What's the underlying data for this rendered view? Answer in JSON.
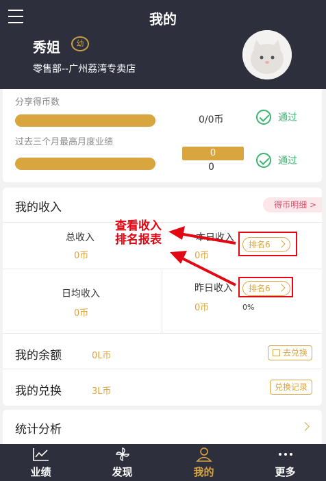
{
  "header": {
    "title": "我的",
    "user_name": "秀姐",
    "badge": "幼",
    "department": "零售部--广州荔湾专卖店"
  },
  "requirements": [
    {
      "label": "分享得币数",
      "value": "0/0币",
      "status": "通过"
    },
    {
      "label": "过去三个月最高月度业绩",
      "box_value": "0",
      "value": "0",
      "status": "通过"
    }
  ],
  "income": {
    "title": "我的收入",
    "detail_link": "得币明细 >",
    "total": {
      "label": "总收入",
      "value": "0币"
    },
    "today": {
      "label": "本日收入",
      "value": "0币",
      "rank": "排名6"
    },
    "daily_avg": {
      "label": "日均收入",
      "value": "0币"
    },
    "yesterday": {
      "label": "昨日收入",
      "value": "0币",
      "rank": "排名6",
      "percent": "0%"
    },
    "annotation": [
      "查看收入",
      "排名报表"
    ]
  },
  "balance": {
    "label": "我的余额",
    "value": "0L币",
    "action": "去兑换"
  },
  "exchange": {
    "label": "我的兑换",
    "value": "3L币",
    "action": "兑换记录"
  },
  "stats": {
    "label": "统计分析"
  },
  "nav": [
    {
      "label": "业绩",
      "icon": "chart-icon"
    },
    {
      "label": "发现",
      "icon": "pinwheel-icon"
    },
    {
      "label": "我的",
      "icon": "person-icon",
      "active": true
    },
    {
      "label": "更多",
      "icon": "more-icon"
    }
  ],
  "colors": {
    "header_bg": "#2e2f3d",
    "accent": "#d9a53f",
    "pass": "#3cb371",
    "annotation": "#e30613"
  }
}
